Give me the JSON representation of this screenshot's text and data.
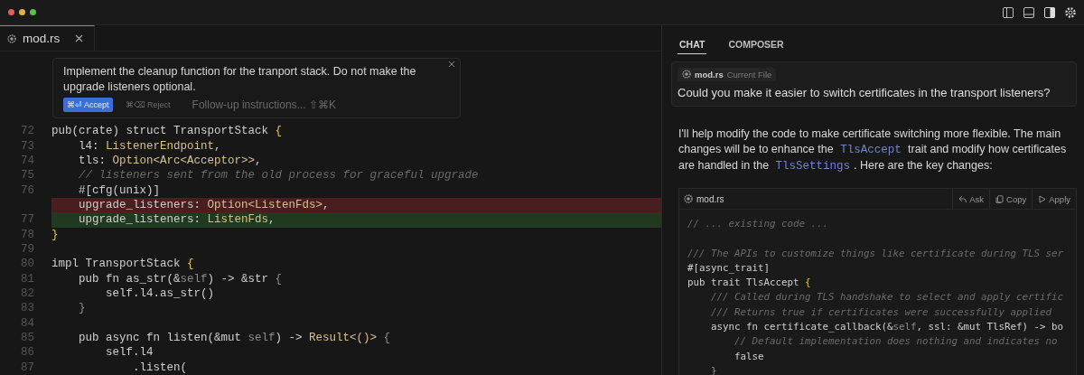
{
  "editor": {
    "tab": {
      "label": "mod.rs",
      "selected": true
    },
    "inline_prompt": {
      "text": "Implement the cleanup function for the tranport stack. Do not make the upgrade listeners optional.",
      "buttons": [
        {
          "label": "⌘⏎ Accept",
          "kind": "primary"
        },
        {
          "label": "⌘⌫ Reject",
          "kind": "secondary"
        }
      ],
      "follow_up": "Follow-up instructions... ⇧⌘K"
    },
    "lines": [
      {
        "number": "72",
        "removed": false,
        "added": false,
        "segments": [
          {
            "text": "pub(crate) struct TransportStack ",
            "kind": "plain"
          },
          {
            "text": "{",
            "kind": "brace"
          }
        ]
      },
      {
        "number": "73",
        "removed": false,
        "added": false,
        "segments": [
          {
            "text": "    l4: ",
            "kind": "plain"
          },
          {
            "text": "ListenerEndpoint",
            "kind": "type"
          },
          {
            "text": ",",
            "kind": "plain"
          }
        ]
      },
      {
        "number": "74",
        "removed": false,
        "added": false,
        "segments": [
          {
            "text": "    tls: ",
            "kind": "plain"
          },
          {
            "text": "Option<Arc<Acceptor>>",
            "kind": "type"
          },
          {
            "text": ",",
            "kind": "plain"
          }
        ]
      },
      {
        "number": "75",
        "removed": false,
        "added": false,
        "segments": [
          {
            "text": "    // listeners sent from the old process for graceful upgrade",
            "kind": "comment"
          }
        ]
      },
      {
        "number": "76",
        "removed": false,
        "added": false,
        "segments": [
          {
            "text": "    #[cfg(unix)]",
            "kind": "plain"
          }
        ]
      },
      {
        "removed": true,
        "added": false,
        "segments": [
          {
            "text": "    upgrade_listeners: ",
            "kind": "plain"
          },
          {
            "text": "Option<ListenFds>",
            "kind": "type"
          },
          {
            "text": ",",
            "kind": "plain"
          }
        ]
      },
      {
        "number": "77",
        "removed": false,
        "added": true,
        "segments": [
          {
            "text": "    upgrade_listeners: ",
            "kind": "plain"
          },
          {
            "text": "ListenFds",
            "kind": "type"
          },
          {
            "text": ",",
            "kind": "plain"
          }
        ]
      },
      {
        "number": "78",
        "removed": false,
        "added": false,
        "segments": [
          {
            "text": "}",
            "kind": "brace"
          }
        ]
      },
      {
        "number": "79"
      },
      {
        "number": "80",
        "removed": false,
        "added": false,
        "segments": [
          {
            "text": "impl TransportStack ",
            "kind": "plain"
          },
          {
            "text": "{",
            "kind": "brace"
          }
        ]
      },
      {
        "number": "81",
        "removed": false,
        "added": false,
        "segments": [
          {
            "text": "    pub fn as_str(&",
            "kind": "plain"
          },
          {
            "text": "self",
            "kind": "dim"
          },
          {
            "text": ") -> &str ",
            "kind": "plain"
          },
          {
            "text": "{",
            "kind": "dim"
          }
        ]
      },
      {
        "number": "82",
        "removed": false,
        "added": false,
        "segments": [
          {
            "text": "        self.l4.as_str()",
            "kind": "plain"
          }
        ]
      },
      {
        "number": "83",
        "removed": false,
        "added": false,
        "segments": [
          {
            "text": "    }",
            "kind": "dim"
          }
        ]
      },
      {
        "number": "84"
      },
      {
        "number": "85",
        "removed": false,
        "added": false,
        "segments": [
          {
            "text": "    pub async fn listen(&mut ",
            "kind": "plain"
          },
          {
            "text": "self",
            "kind": "dim"
          },
          {
            "text": ") -> ",
            "kind": "plain"
          },
          {
            "text": "Result<()>",
            "kind": "type"
          },
          {
            "text": " {",
            "kind": "dim"
          }
        ]
      },
      {
        "number": "86",
        "removed": false,
        "added": false,
        "segments": [
          {
            "text": "        self.l4",
            "kind": "plain"
          }
        ]
      },
      {
        "number": "87",
        "removed": false,
        "added": false,
        "segments": [
          {
            "text": "            .listen(",
            "kind": "plain"
          }
        ]
      }
    ]
  },
  "chat": {
    "tabs": [
      {
        "label": "CHAT",
        "selected": true
      },
      {
        "label": "COMPOSER",
        "selected": false
      }
    ],
    "question": {
      "file": "mod.rs",
      "file_note": "Current File",
      "text": "Could you make it easier to switch certificates in the transport listeners?"
    },
    "response": [
      {
        "text": "I'll help modify the code to make certificate switching more flexible. The main changes will be to enhance the ",
        "kind": "text"
      },
      {
        "text": "TlsAccept",
        "kind": "code"
      },
      {
        "text": " trait and modify how certificates are handled in the ",
        "kind": "text"
      },
      {
        "text": "TlsSettings",
        "kind": "code"
      },
      {
        "text": ". Here are the key changes:",
        "kind": "text"
      }
    ],
    "code_block": {
      "file": "mod.rs",
      "actions": [
        {
          "label": "Ask",
          "kind": "ask"
        },
        {
          "label": "Copy",
          "kind": "copy"
        },
        {
          "label": "Apply",
          "kind": "apply"
        }
      ],
      "lines": [
        {
          "kind": "code",
          "segments": [
            {
              "text": "// ... existing code ...",
              "kind": "comment"
            }
          ]
        },
        {
          "kind": "blank"
        },
        {
          "kind": "code",
          "segments": [
            {
              "text": "/// The APIs to customize things like certificate during TLS ser",
              "kind": "comment"
            }
          ]
        },
        {
          "kind": "code",
          "segments": [
            {
              "text": "#[async_trait]",
              "kind": "plain"
            }
          ]
        },
        {
          "kind": "code",
          "segments": [
            {
              "text": "pub trait TlsAccept ",
              "kind": "plain"
            },
            {
              "text": "{",
              "kind": "brace"
            }
          ]
        },
        {
          "kind": "code",
          "segments": [
            {
              "text": "    /// Called during TLS handshake to select and apply certific",
              "kind": "comment"
            }
          ]
        },
        {
          "kind": "code",
          "segments": [
            {
              "text": "    /// Returns true if certificates were successfully applied",
              "kind": "comment"
            }
          ]
        },
        {
          "kind": "code",
          "segments": [
            {
              "text": "    async fn certificate_callback(&",
              "kind": "plain"
            },
            {
              "text": "self",
              "kind": "dim"
            },
            {
              "text": ", ssl: &mut TlsRef) -> bo",
              "kind": "plain"
            }
          ]
        },
        {
          "kind": "code",
          "segments": [
            {
              "text": "        // Default implementation does nothing and indicates no",
              "kind": "comment"
            }
          ]
        },
        {
          "kind": "code",
          "segments": [
            {
              "text": "        false",
              "kind": "plain"
            }
          ]
        },
        {
          "kind": "code",
          "segments": [
            {
              "text": "    }",
              "kind": "dim"
            }
          ]
        }
      ]
    }
  }
}
